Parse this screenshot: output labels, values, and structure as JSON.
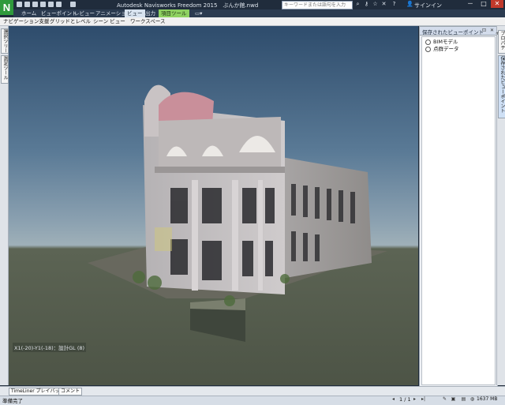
{
  "titlebar": {
    "app_logo": "N",
    "title": "Autodesk Navisworks Freedom 2015　ぶんか館.nwd",
    "search_placeholder": "キーワードまたは語句を入力",
    "signin": "サインイン",
    "window_buttons": [
      "－",
      "□",
      "✕"
    ]
  },
  "ribbon": {
    "tabs": [
      {
        "label": "ホーム"
      },
      {
        "label": "ビューポイント"
      },
      {
        "label": "レビュー"
      },
      {
        "label": "アニメーション"
      },
      {
        "label": "ビュー"
      },
      {
        "label": "出力"
      },
      {
        "label": "項目ツール"
      }
    ],
    "active_tab": "ビュー",
    "special_tab": "項目ツール"
  },
  "navbar": {
    "items": [
      "ナビゲーション支援",
      "グリッドとレベル",
      "シーン ビュー",
      "ワークスペース"
    ]
  },
  "left_panel": {
    "tabs": [
      "選択ツリー",
      "測定ツール"
    ]
  },
  "viewport": {
    "coord_readout": "X1(-20)-Y1(-18)：設計GL (8)"
  },
  "saved_viewpoints": {
    "title": "保存されたビューポイント",
    "items": [
      "BIMモデル",
      "点群データ"
    ]
  },
  "right_strip": {
    "tabs": [
      "プロパティ",
      "保存されたビューポイント"
    ]
  },
  "bottom_tabs": [
    "TimeLiner プレイバック",
    "コメント"
  ],
  "status": {
    "text": "準備完了",
    "page": "1 / 1",
    "memory": "1637 MB"
  },
  "colors": {
    "accent": "#2f9a3c",
    "special_tab": "#8ed161",
    "titlebar": "#202c3c"
  }
}
